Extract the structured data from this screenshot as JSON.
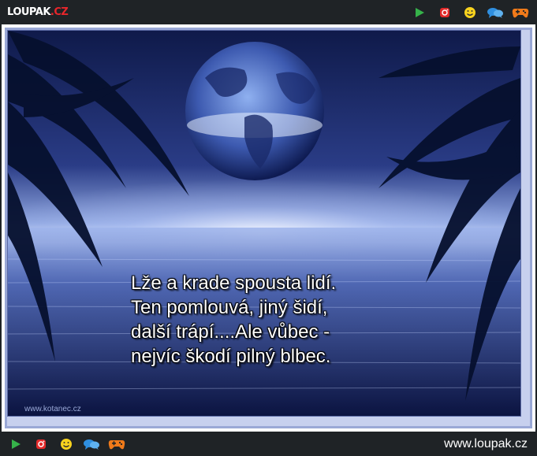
{
  "header": {
    "logo_main": "LOUPAK",
    "logo_dot": ".",
    "logo_tld": "CZ",
    "icons": [
      "play-icon",
      "instagram-icon",
      "smiley-icon",
      "chat-icon",
      "gamepad-icon"
    ]
  },
  "image": {
    "poem_lines": [
      "Lže a krade spousta lidí.",
      "Ten pomlouvá, jiný šidí,",
      "další trápí....Ale vůbec -",
      "nejvíc škodí pilný blbec."
    ],
    "watermark": "www.kotanec.cz"
  },
  "footer": {
    "icons": [
      "play-icon",
      "instagram-icon",
      "smiley-icon",
      "chat-icon",
      "gamepad-icon"
    ],
    "site_url": "www.loupak.cz"
  },
  "colors": {
    "bar": "#1f2326",
    "play": "#36b34a",
    "instagram": "#e32a2a",
    "smiley": "#f7d21e",
    "chat": "#2f8fe0",
    "gamepad": "#f07a1a",
    "logo_accent": "#e8262b"
  }
}
